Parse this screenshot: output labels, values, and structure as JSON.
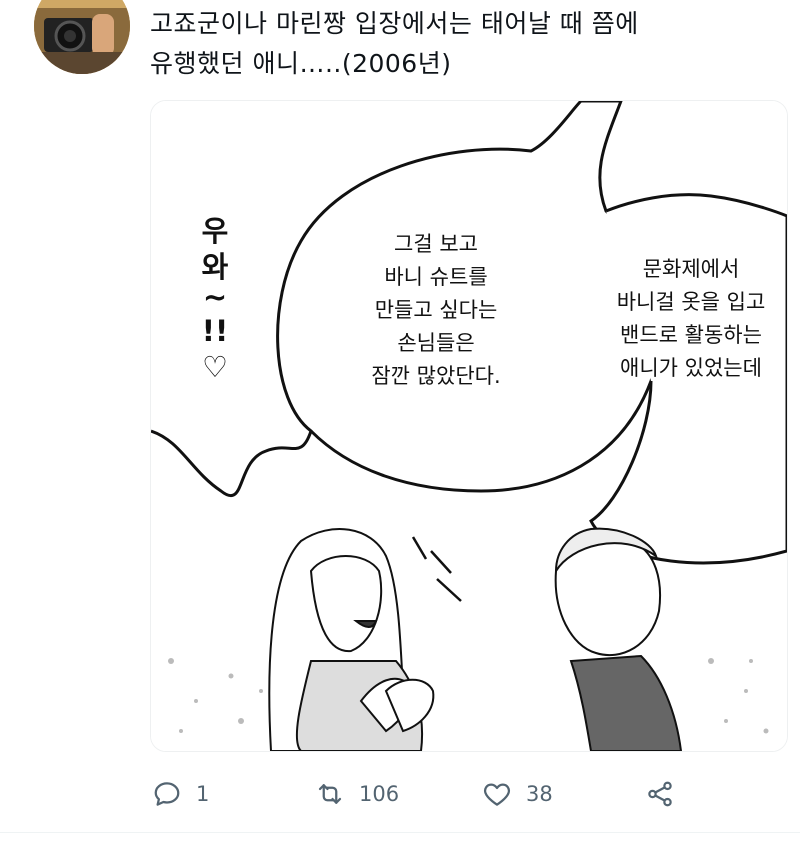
{
  "tweet": {
    "text_line1": "고죠군이나 마린짱 입장에서는 태어날 때 쯤에",
    "text_line2": "유행했던 애니…..(2006년)"
  },
  "media": {
    "sfx_chars": [
      "우",
      "와",
      "~",
      "!!",
      "♡"
    ],
    "bubble_left": [
      "그걸 보고",
      "바니 슈트를",
      "만들고 싶다는",
      "손님들은",
      "잠깐 많았단다."
    ],
    "bubble_right": [
      "문화제에서",
      "바니걸 옷을 입고",
      "밴드로 활동하는",
      "애니가 있었는데"
    ]
  },
  "actions": {
    "reply_count": "1",
    "retweet_count": "106",
    "like_count": "38"
  },
  "icons": {
    "reply": "reply-icon",
    "retweet": "retweet-icon",
    "like": "heart-icon",
    "share": "share-icon"
  }
}
